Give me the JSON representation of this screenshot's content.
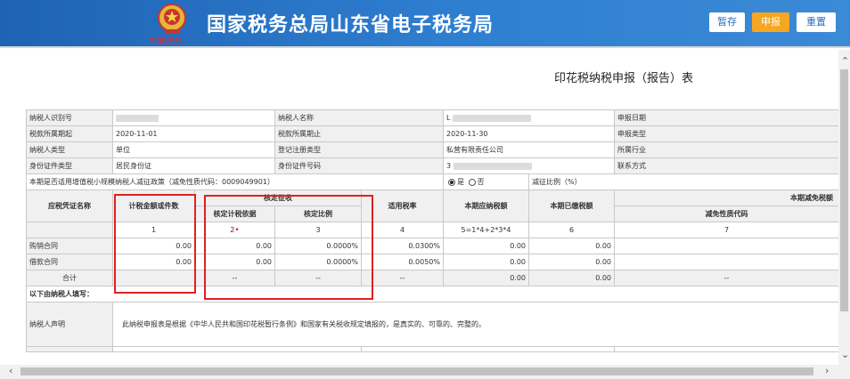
{
  "header": {
    "site_title": "国家税务总局山东省电子税务局",
    "emblem_caption": "中国税务",
    "buttons": {
      "save": "暂存",
      "submit": "申报",
      "reset": "重置"
    }
  },
  "form_title": "印花税纳税申报（报告）表",
  "info": {
    "taxpayer_id_label": "纳税人识别号",
    "taxpayer_name_label": "纳税人名称",
    "taxpayer_name_value": "L",
    "declare_date_label": "申报日期",
    "period_start_label": "税款所属期起",
    "period_start_value": "2020-11-01",
    "period_end_label": "税款所属期止",
    "period_end_value": "2020-11-30",
    "declare_type_label": "申报类型",
    "taxpayer_type_label": "纳税人类型",
    "taxpayer_type_value": "单位",
    "reg_type_label": "登记注册类型",
    "reg_type_value": "私营有限责任公司",
    "industry_label": "所属行业",
    "id_type_label": "身份证件类型",
    "id_type_value": "居民身份证",
    "id_no_label": "身份证件号码",
    "id_no_value": "3",
    "contact_label": "联系方式",
    "relief_question": "本期是否适用增值税小规模纳税人减征政策（减免性质代码：0009049901）",
    "radio_yes": "是",
    "radio_no": "否",
    "relief_ratio_label": "减征比例（%）"
  },
  "table": {
    "col_name": "应税凭证名称",
    "col_amount": "计税金额或件数",
    "col_verified": "核定征收",
    "col_verified_basis": "核定计税依据",
    "col_verified_ratio": "核定比例",
    "col_rate": "适用税率",
    "col_payable": "本期应纳税额",
    "col_paid": "本期已缴税额",
    "col_relief": "本期减免税额",
    "col_relief_code": "减免性质代码",
    "idx": [
      "1",
      "2",
      "3",
      "4",
      "5=1*4+2*3*4",
      "6",
      "7"
    ],
    "rows": [
      {
        "name": "购销合同",
        "amount": "0.00",
        "basis": "0.00",
        "ratio": "0.0000%",
        "rate": "0.0300%",
        "payable": "0.00",
        "paid": "0.00"
      },
      {
        "name": "借款合同",
        "amount": "0.00",
        "basis": "0.00",
        "ratio": "0.0000%",
        "rate": "0.0050%",
        "payable": "0.00",
        "paid": "0.00"
      }
    ],
    "total": {
      "name": "合计",
      "basis": "--",
      "ratio": "--",
      "rate": "--",
      "payable": "0.00",
      "paid": "0.00",
      "code": "--"
    }
  },
  "footer": {
    "fill_by_taxpayer": "以下由纳税人填写：",
    "declaration_label": "纳税人声明",
    "declaration_text": "此纳税申报表是根据《中华人民共和国印花税暂行条例》和国家有关税收规定填报的，是真实的、可靠的、完整的。"
  }
}
